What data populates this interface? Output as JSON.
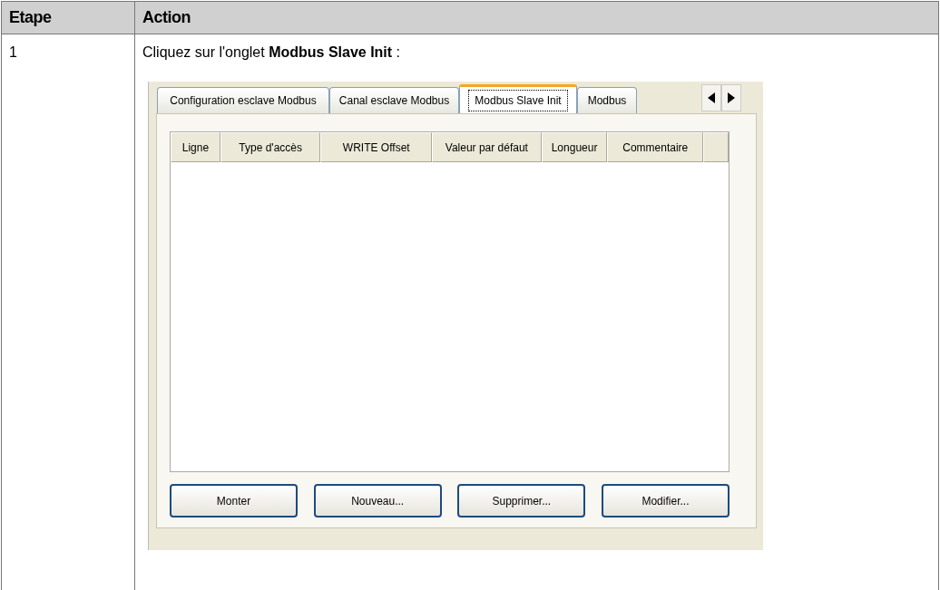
{
  "table": {
    "columns": [
      "Etape",
      "Action"
    ],
    "rows": [
      {
        "step": "1",
        "instruction": "Cliquez sur l'onglet **Modbus Slave Init** :",
        "screenshot": {
          "tabs": [
            {
              "label": "Configuration esclave Modbus",
              "selected": false
            },
            {
              "label": "Canal esclave Modbus",
              "selected": false
            },
            {
              "label": "Modbus Slave Init",
              "selected": true
            },
            {
              "label": "Modbus",
              "selected": false
            }
          ],
          "grid_columns": [
            "Ligne",
            "Type d'accès",
            "WRITE Offset",
            "Valeur par défaut",
            "Longueur",
            "Commentaire"
          ],
          "buttons": [
            "Monter",
            "Nouveau...",
            "Supprimer...",
            "Modifier..."
          ]
        }
      }
    ]
  }
}
